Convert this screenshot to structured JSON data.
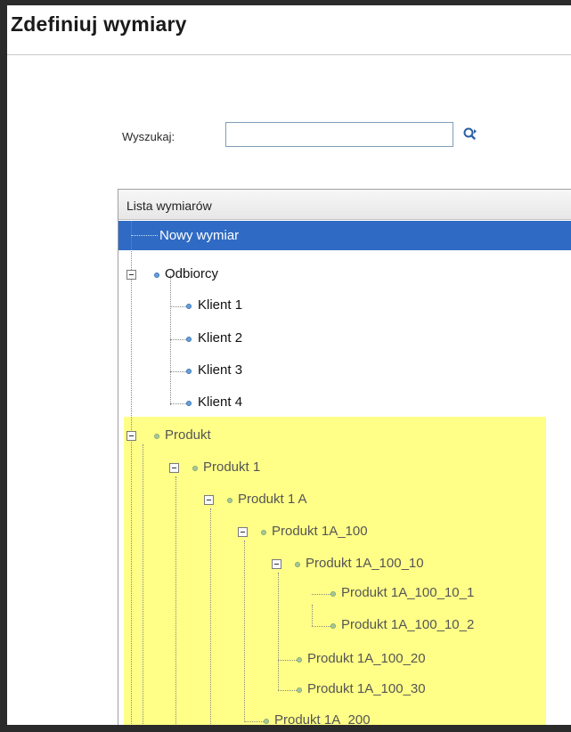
{
  "page": {
    "title": "Zdefiniuj wymiary"
  },
  "search": {
    "label": "Wyszukaj:",
    "value": "",
    "placeholder": ""
  },
  "tree": {
    "header": "Lista wymiarów",
    "nodes": {
      "new_dimension": "Nowy wymiar",
      "odbiorcy": "Odbiorcy",
      "klient1": "Klient 1",
      "klient2": "Klient 2",
      "klient3": "Klient 3",
      "klient4": "Klient 4",
      "produkt": "Produkt",
      "produkt1": "Produkt 1",
      "produkt1a": "Produkt 1 A",
      "produkt1a_100": "Produkt 1A_100",
      "produkt1a_100_10": "Produkt 1A_100_10",
      "produkt1a_100_10_1": "Produkt 1A_100_10_1",
      "produkt1a_100_10_2": "Produkt 1A_100_10_2",
      "produkt1a_100_20": "Produkt 1A_100_20",
      "produkt1a_100_30": "Produkt 1A_100_30",
      "produkt1a_200": "Produkt 1A_200"
    }
  },
  "colors": {
    "selection": "#2f6bc4",
    "highlight": "#ffff88"
  }
}
